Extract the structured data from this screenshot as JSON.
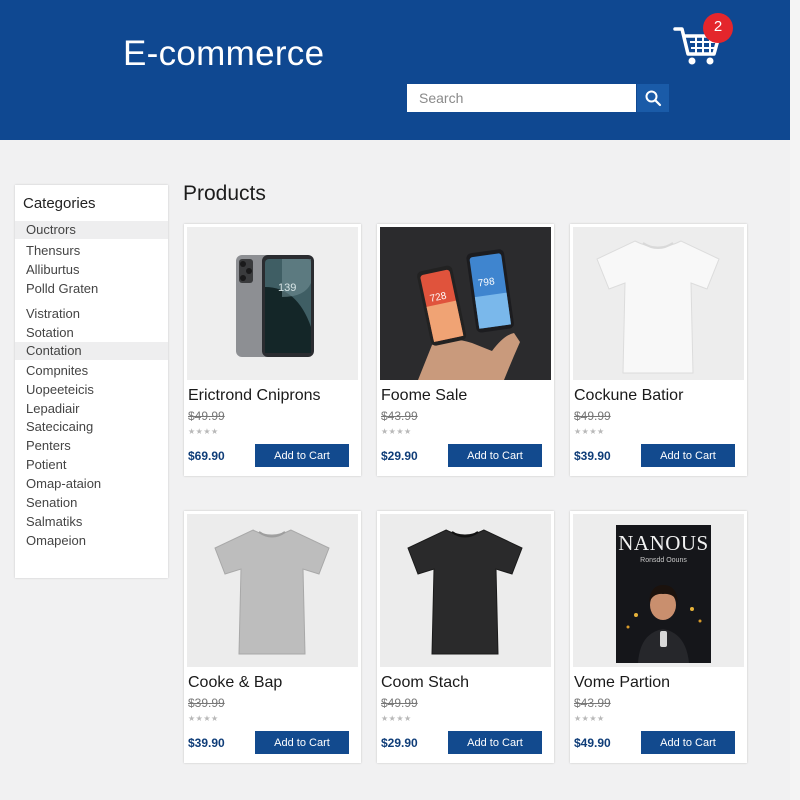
{
  "header": {
    "brand": "E-commerce",
    "search": {
      "placeholder": "Search"
    },
    "cart": {
      "count": "2"
    }
  },
  "sidebar": {
    "title": "Categories",
    "items": [
      {
        "label": "Ouctrors"
      },
      {
        "label": "Thensurs"
      },
      {
        "label": "Alliburtus"
      },
      {
        "label": "Polld Graten"
      },
      {
        "label": "Vistration"
      },
      {
        "label": "Sotation"
      },
      {
        "label": "Contation"
      },
      {
        "label": "Compnites"
      },
      {
        "label": "Uopeeteicis"
      },
      {
        "label": "Lepadiair"
      },
      {
        "label": "Satecicaing"
      },
      {
        "label": "Penters"
      },
      {
        "label": "Potient"
      },
      {
        "label": "Omap-ataion"
      },
      {
        "label": "Senation"
      },
      {
        "label": "Salmatiks"
      },
      {
        "label": "Omapeion"
      }
    ]
  },
  "main": {
    "title": "Products",
    "products": [
      {
        "name": "Erictrond Cniprons",
        "old_price": "$49.99",
        "price": "$69.90",
        "button": "Add to Cart",
        "image": "smartphone-image",
        "rating": "★★★★"
      },
      {
        "name": "Foome Sale",
        "old_price": "$43.99",
        "price": "$29.90",
        "button": "Add to Cart",
        "image": "phones-in-hand-image",
        "rating": "★★★★"
      },
      {
        "name": "Cockune Batior",
        "old_price": "$49.99",
        "price": "$39.90",
        "button": "Add to Cart",
        "image": "white-tshirt-image",
        "rating": "★★★★"
      },
      {
        "name": "Cooke & Bap",
        "old_price": "$39.99",
        "price": "$39.90",
        "button": "Add to Cart",
        "image": "gray-tshirt-image",
        "rating": "★★★★"
      },
      {
        "name": "Coom Stach",
        "old_price": "$49.99",
        "price": "$29.90",
        "button": "Add to Cart",
        "image": "black-tshirt-image",
        "rating": "★★★★"
      },
      {
        "name": "Vome Partion",
        "old_price": "$43.99",
        "price": "$49.90",
        "button": "Add to Cart",
        "image": "book-cover-image",
        "rating": "★★★★",
        "book": {
          "title": "NANOUS",
          "subtitle": "Ronsdd Oouns"
        }
      }
    ]
  },
  "colors": {
    "header": "#0f4891",
    "button": "#124a8e",
    "badge": "#e4262c",
    "price": "#0f3d78"
  }
}
